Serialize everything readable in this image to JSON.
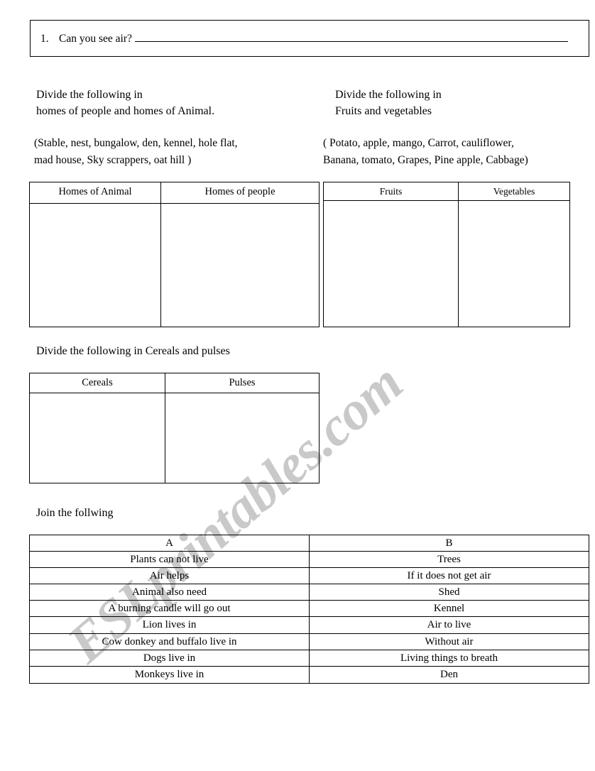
{
  "question_one": {
    "number": "1.",
    "text": "Can you see air?"
  },
  "sections": {
    "homes": {
      "instruction": "Divide the following in\nhomes of people and homes of Animal.",
      "word_bank": "(Stable, nest, bungalow, den, kennel, hole flat,\n mad house, Sky scrappers, oat hill )",
      "columns": [
        "Homes of Animal",
        "Homes of people"
      ]
    },
    "fruits": {
      "instruction": "Divide the following in\nFruits and vegetables",
      "word_bank": "( Potato, apple, mango, Carrot, cauliflower,\n Banana, tomato, Grapes, Pine apple, Cabbage)",
      "columns": [
        "Fruits",
        "Vegetables"
      ]
    },
    "cereals": {
      "instruction": "Divide the following in  Cereals and pulses",
      "columns": [
        "Cereals",
        "Pulses"
      ]
    },
    "join": {
      "instruction": "Join the follwing",
      "headers": [
        "A",
        "B"
      ],
      "rows": [
        {
          "a": "Plants can not live",
          "b": "Trees"
        },
        {
          "a": "Air helps",
          "b": "If it does not get air"
        },
        {
          "a": "Animal also need",
          "b": "Shed"
        },
        {
          "a": "A burning candle will go out",
          "b": "Kennel"
        },
        {
          "a": "Lion lives in",
          "b": "Air to live"
        },
        {
          "a": "Cow donkey and buffalo live in",
          "b": "Without air"
        },
        {
          "a": "Dogs live in",
          "b": "Living things to breath"
        },
        {
          "a": "Monkeys live in",
          "b": "Den"
        }
      ]
    }
  },
  "watermark": {
    "text": "ESLprintables.com",
    "color": "#c9c9c9"
  }
}
